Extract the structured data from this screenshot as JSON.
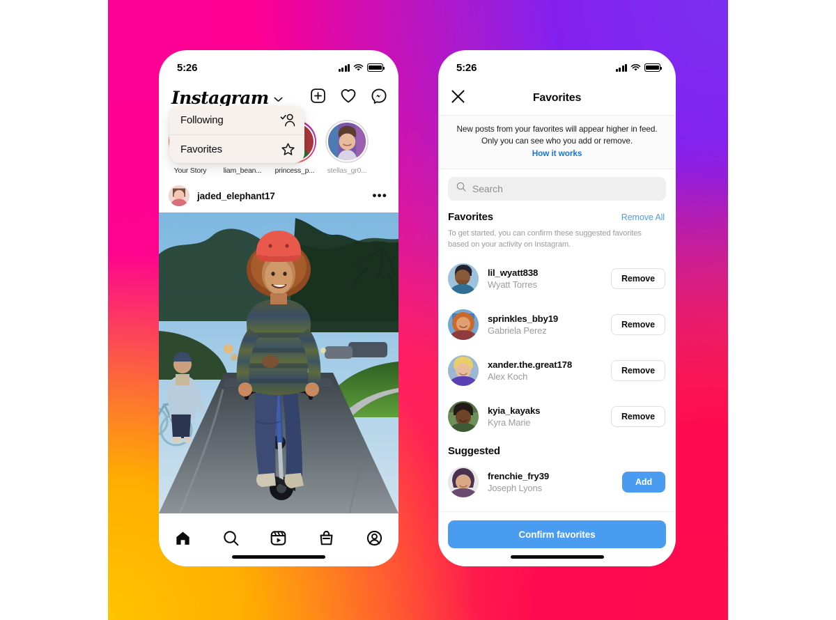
{
  "background": {
    "colors": {
      "top_left": "#ff0095",
      "top_right": "#7c2ff2",
      "bottom_left": "#ffc400",
      "bottom_right": "#ff0b4f"
    }
  },
  "phone_left": {
    "status_bar": {
      "time": "5:26",
      "signal_icon": "cellular-signal-icon",
      "wifi_icon": "wifi-icon",
      "battery_icon": "battery-icon"
    },
    "header": {
      "wordmark": "Instagram",
      "caret_icon": "chevron-down-icon",
      "actions": [
        {
          "name": "new-post-button",
          "icon": "plus-square-icon"
        },
        {
          "name": "activity-button",
          "icon": "heart-icon"
        },
        {
          "name": "messenger-button",
          "icon": "messenger-icon"
        }
      ]
    },
    "dropdown": {
      "items": [
        {
          "label": "Following",
          "icon": "following-person-check-icon"
        },
        {
          "label": "Favorites",
          "icon": "star-icon"
        }
      ]
    },
    "stories": [
      {
        "label": "Your Story",
        "muted": false,
        "ring": "gradient"
      },
      {
        "label": "liam_bean...",
        "muted": false,
        "ring": "gradient"
      },
      {
        "label": "princess_p...",
        "muted": false,
        "ring": "gradient"
      },
      {
        "label": "stellas_gr0...",
        "muted": true,
        "ring": "plain"
      }
    ],
    "post": {
      "username": "jaded_elephant17",
      "more_glyph": "•••",
      "photo_alt": "Two kids riding a scooter and a bicycle down a suburban street at dusk"
    },
    "tabbar": [
      {
        "name": "tab-home",
        "icon": "home-icon",
        "active": true
      },
      {
        "name": "tab-search",
        "icon": "search-icon",
        "active": false
      },
      {
        "name": "tab-reels",
        "icon": "reels-icon",
        "active": false
      },
      {
        "name": "tab-shop",
        "icon": "shop-bag-icon",
        "active": false
      },
      {
        "name": "tab-profile",
        "icon": "profile-circle-icon",
        "active": false
      }
    ]
  },
  "phone_right": {
    "status_bar": {
      "time": "5:26",
      "signal_icon": "cellular-signal-icon",
      "wifi_icon": "wifi-icon",
      "battery_icon": "battery-icon"
    },
    "navbar": {
      "close_icon": "close-x-icon",
      "title": "Favorites"
    },
    "explainer": {
      "line1": "New posts from your favorites will appear higher in feed.",
      "line2": "Only you can see who you add or remove.",
      "link": "How it works"
    },
    "search": {
      "icon": "search-icon",
      "placeholder": "Search",
      "value": ""
    },
    "favorites_section": {
      "title": "Favorites",
      "action_label": "Remove All",
      "subtext": "To get started, you can confirm these suggested favorites based on your activity on Instagram.",
      "rows": [
        {
          "username": "lil_wyatt838",
          "fullname": "Wyatt Torres",
          "button": "Remove",
          "button_style": "remove"
        },
        {
          "username": "sprinkles_bby19",
          "fullname": "Gabriela Perez",
          "button": "Remove",
          "button_style": "remove"
        },
        {
          "username": "xander.the.great178",
          "fullname": "Alex Koch",
          "button": "Remove",
          "button_style": "remove"
        },
        {
          "username": "kyia_kayaks",
          "fullname": "Kyra Marie",
          "button": "Remove",
          "button_style": "remove"
        }
      ]
    },
    "suggested_section": {
      "title": "Suggested",
      "rows": [
        {
          "username": "frenchie_fry39",
          "fullname": "Joseph Lyons",
          "button": "Add",
          "button_style": "add"
        }
      ]
    },
    "confirm_button": {
      "label": "Confirm favorites",
      "color": "#4a9cf0"
    }
  }
}
